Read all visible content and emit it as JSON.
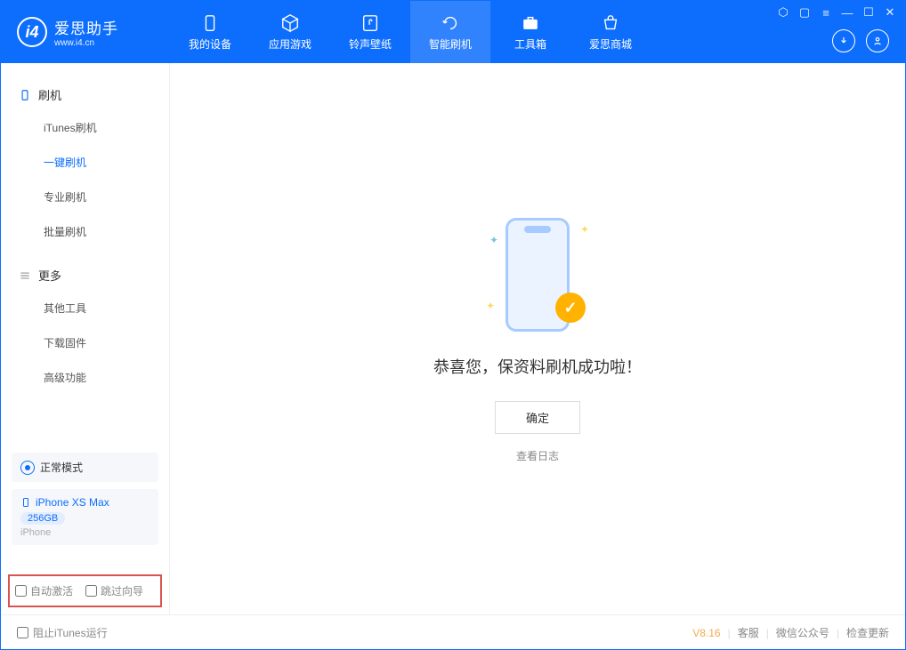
{
  "app": {
    "title": "爱思助手",
    "subtitle": "www.i4.cn"
  },
  "nav": [
    {
      "label": "我的设备"
    },
    {
      "label": "应用游戏"
    },
    {
      "label": "铃声壁纸"
    },
    {
      "label": "智能刷机"
    },
    {
      "label": "工具箱"
    },
    {
      "label": "爱思商城"
    }
  ],
  "sidebar": {
    "group1": "刷机",
    "items1": [
      "iTunes刷机",
      "一键刷机",
      "专业刷机",
      "批量刷机"
    ],
    "group2": "更多",
    "items2": [
      "其他工具",
      "下载固件",
      "高级功能"
    ]
  },
  "device": {
    "mode": "正常模式",
    "name": "iPhone XS Max",
    "capacity": "256GB",
    "type": "iPhone"
  },
  "options": {
    "auto_activate": "自动激活",
    "skip_guide": "跳过向导"
  },
  "main": {
    "success": "恭喜您，保资料刷机成功啦！",
    "ok": "确定",
    "view_log": "查看日志"
  },
  "footer": {
    "block_itunes": "阻止iTunes运行",
    "version": "V8.16",
    "support": "客服",
    "wechat": "微信公众号",
    "update": "检查更新"
  }
}
